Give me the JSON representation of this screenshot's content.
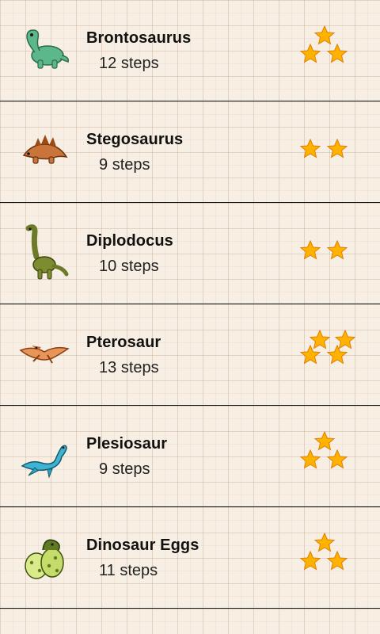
{
  "levels": [
    {
      "name": "Brontosaurus",
      "steps": "12",
      "steps_unit": "steps",
      "stars": 3,
      "icon": "brontosaurus-icon",
      "color": "#5cb88a"
    },
    {
      "name": "Stegosaurus",
      "steps": "9",
      "steps_unit": "steps",
      "stars": 2,
      "icon": "stegosaurus-icon",
      "color": "#b8621e"
    },
    {
      "name": "Diplodocus",
      "steps": "10",
      "steps_unit": "steps",
      "stars": 2,
      "icon": "diplodocus-icon",
      "color": "#6c7a2a"
    },
    {
      "name": "Pterosaur",
      "steps": "13",
      "steps_unit": "steps",
      "stars": 4,
      "icon": "pterosaur-icon",
      "color": "#e2894a"
    },
    {
      "name": "Plesiosaur",
      "steps": "9",
      "steps_unit": "steps",
      "stars": 3,
      "icon": "plesiosaur-icon",
      "color": "#2fa3c2"
    },
    {
      "name": "Dinosaur Eggs",
      "steps": "11",
      "steps_unit": "steps",
      "stars": 3,
      "icon": "dinosaur-eggs-icon",
      "color": "#8fb23a"
    }
  ],
  "star_color": "#ffb300"
}
